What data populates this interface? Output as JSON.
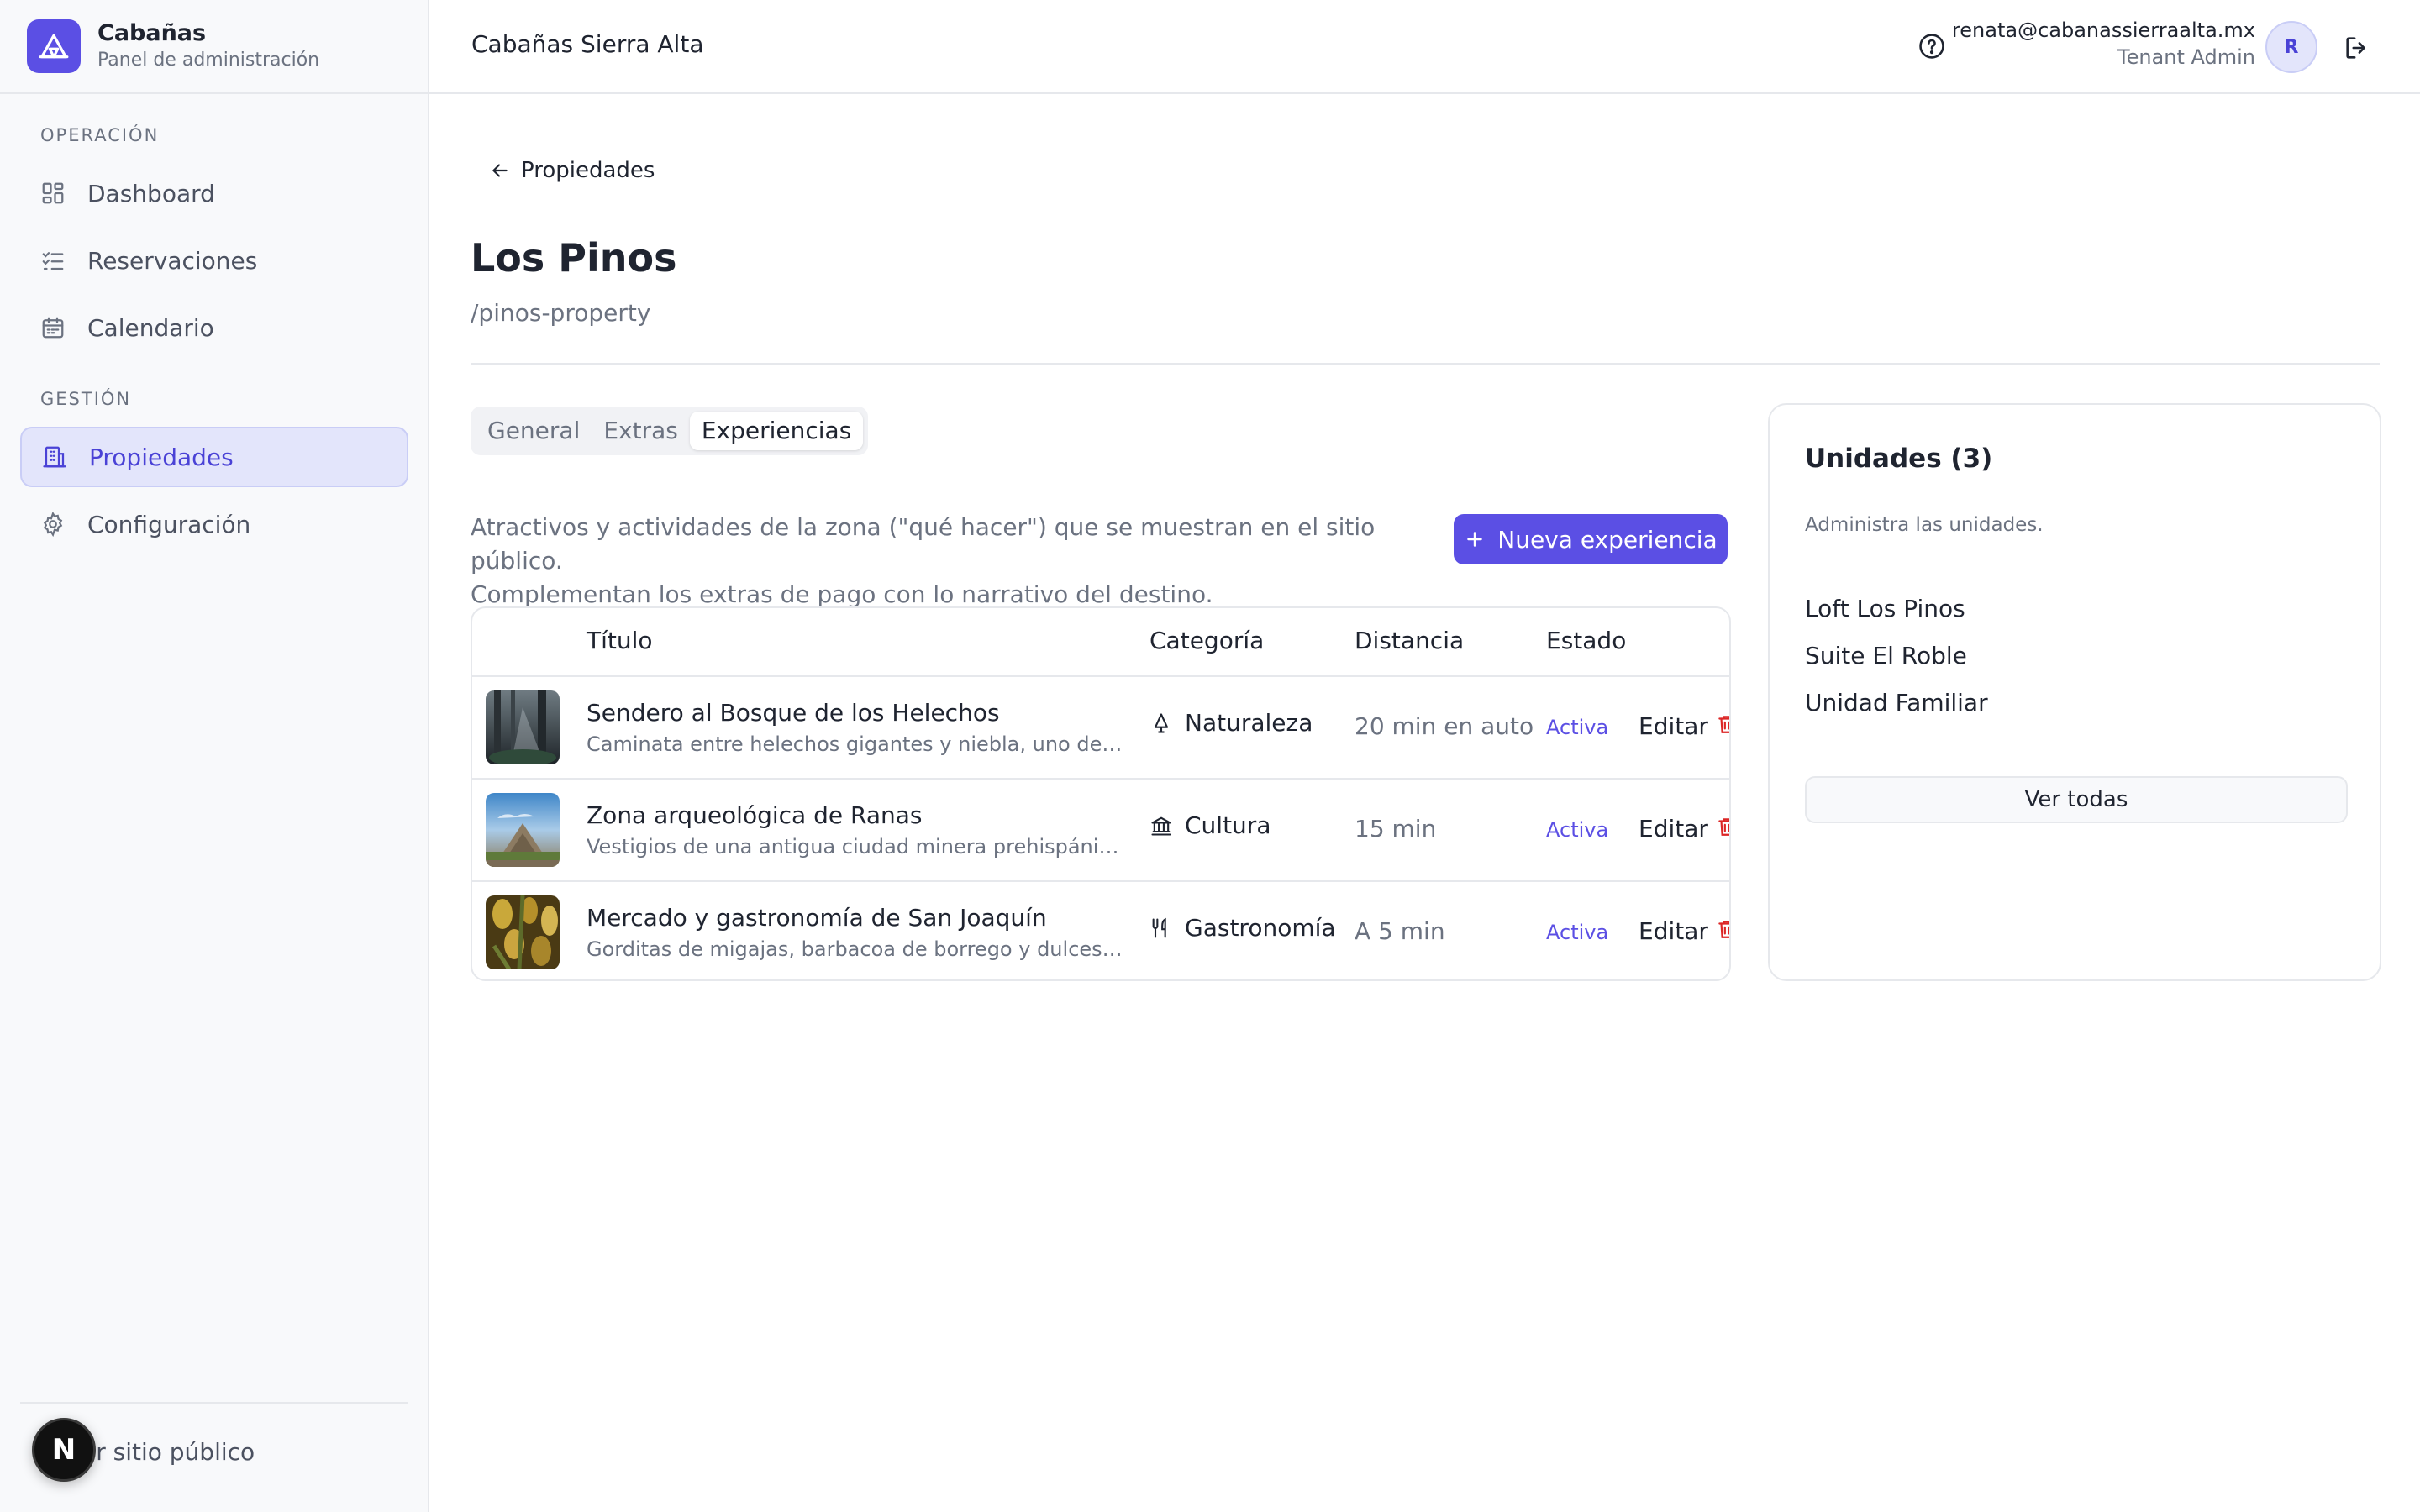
{
  "brand": {
    "name": "Cabañas",
    "subtitle": "Panel de administración"
  },
  "sidebar": {
    "sections": [
      {
        "label": "OPERACIÓN"
      },
      {
        "label": "GESTIÓN"
      }
    ],
    "items": [
      {
        "label": "Dashboard",
        "icon": "dashboard-icon"
      },
      {
        "label": "Reservaciones",
        "icon": "checklist-icon"
      },
      {
        "label": "Calendario",
        "icon": "calendar-icon"
      },
      {
        "label": "Propiedades",
        "icon": "building-icon",
        "active": true
      },
      {
        "label": "Configuración",
        "icon": "gear-icon"
      }
    ],
    "footer_link": "Ver sitio público",
    "badge": "N"
  },
  "header": {
    "title": "Cabañas Sierra Alta",
    "user_email": "renata@cabanassierraalta.mx",
    "user_role": "Tenant Admin",
    "avatar_initial": "R"
  },
  "page": {
    "back_label": "Propiedades",
    "title": "Los Pinos",
    "slug": "/pinos-property",
    "tabs": [
      {
        "label": "General"
      },
      {
        "label": "Extras"
      },
      {
        "label": "Experiencias",
        "active": true
      }
    ],
    "description_line1": "Atractivos y actividades de la zona (\"qué hacer\") que se muestran en el sitio público.",
    "description_line2": "Complementan los extras de pago con lo narrativo del destino.",
    "new_button": "Nueva experiencia"
  },
  "table": {
    "columns": [
      "Título",
      "Categoría",
      "Distancia",
      "Estado"
    ],
    "rows": [
      {
        "title": "Sendero al Bosque de los Helechos",
        "subtitle": "Caminata entre helechos gigantes y niebla, uno de los paisajes más fotografiados",
        "category": "Naturaleza",
        "category_icon": "tree-icon",
        "distance": "20 min en auto",
        "status": "Activa",
        "edit": "Editar"
      },
      {
        "title": "Zona arqueológica de Ranas",
        "subtitle": "Vestigios de una antigua ciudad minera prehispánica entre la sierra",
        "category": "Cultura",
        "category_icon": "landmark-icon",
        "distance": "15 min",
        "status": "Activa",
        "edit": "Editar"
      },
      {
        "title": "Mercado y gastronomía de San Joaquín",
        "subtitle": "Gorditas de migajas, barbacoa de borrego y dulces típicos de la región",
        "category": "Gastronomía",
        "category_icon": "utensils-icon",
        "distance": "A 5 min",
        "status": "Activa",
        "edit": "Editar"
      }
    ]
  },
  "units": {
    "title": "Unidades (3)",
    "subtitle": "Administra las unidades.",
    "items": [
      "Loft Los Pinos",
      "Suite El Roble",
      "Unidad Familiar"
    ],
    "see_all": "Ver todas"
  },
  "colors": {
    "accent": "#5b4fe4",
    "active_nav_bg": "#e3e5fb",
    "delete": "#dc2626"
  }
}
